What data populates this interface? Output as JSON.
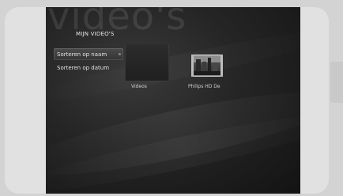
{
  "watermark": "video's",
  "page": {
    "title": "MIJN VIDEO'S"
  },
  "menu": {
    "items": [
      {
        "label": "Sorteren op naam"
      },
      {
        "label": "Sorteren op datum"
      }
    ]
  },
  "tiles": [
    {
      "label": "Videos",
      "icon": "folder-icon"
    },
    {
      "label": "Philips HD De",
      "icon": "video-thumbnail"
    }
  ],
  "colors": {
    "screen_bg": "#1f1f1f",
    "bezel": "#e1e1e1",
    "text": "#e3e3e3"
  }
}
